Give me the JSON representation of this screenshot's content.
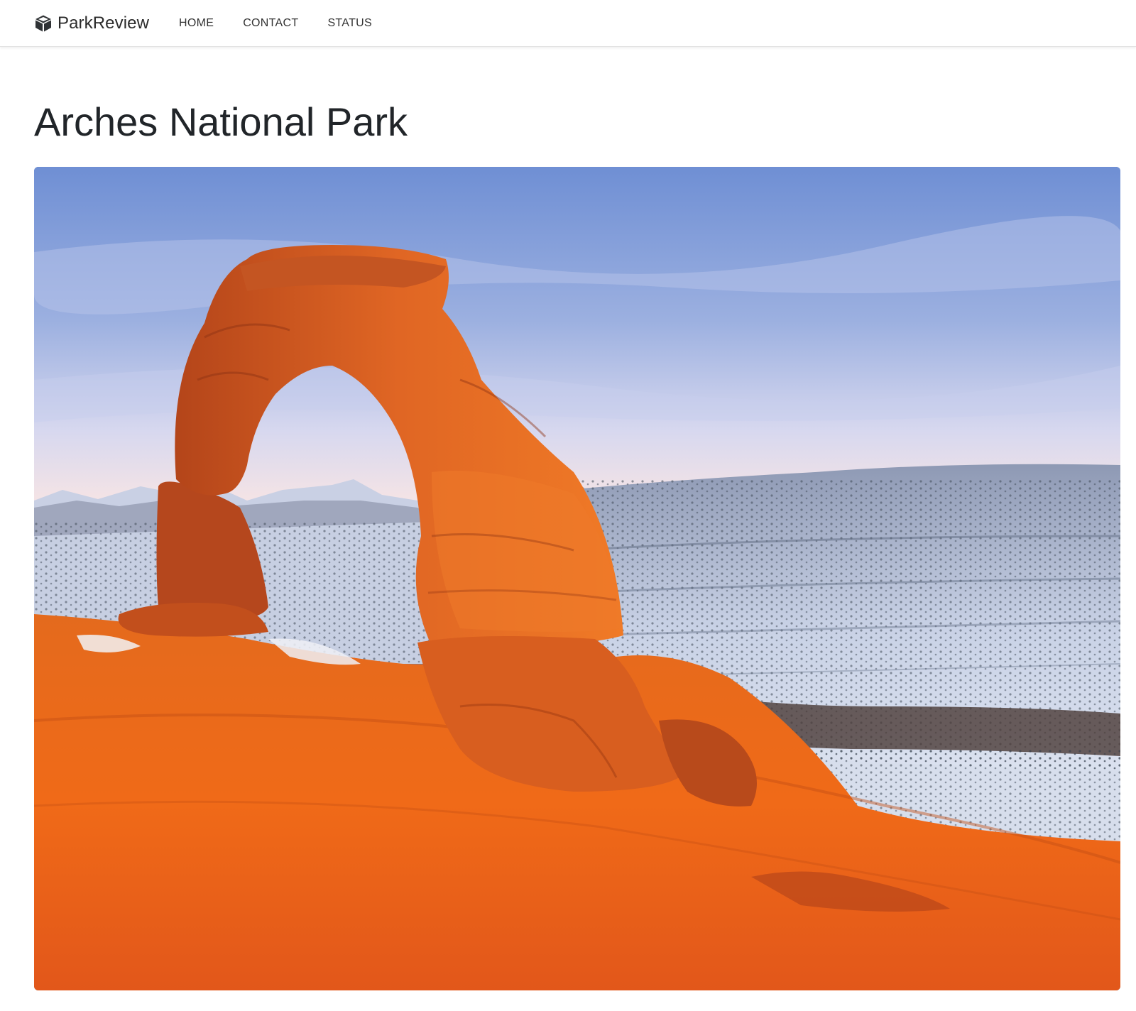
{
  "navbar": {
    "brand": "ParkReview",
    "brand_icon": "cube-icon",
    "links": [
      {
        "label": "HOME"
      },
      {
        "label": "CONTACT"
      },
      {
        "label": "STATUS"
      }
    ]
  },
  "main": {
    "title": "Arches National Park",
    "hero_image": {
      "subject": "delicate-arch-photo"
    }
  },
  "colors": {
    "text": "#212529",
    "sky_top": "#5f82c9",
    "sky_bottom": "#f5e7e4",
    "rock_main": "#e8651d",
    "rock_shadow": "#a83a12",
    "snow": "#dfe6f2"
  }
}
